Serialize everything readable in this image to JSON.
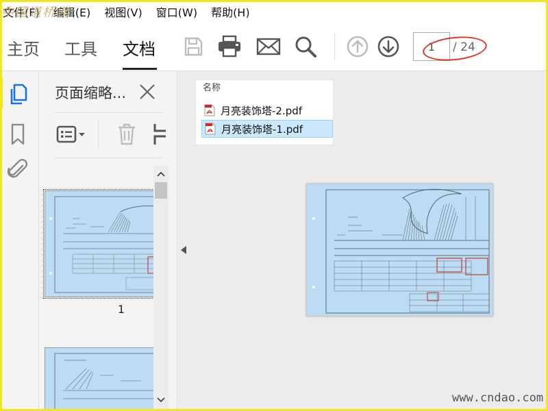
{
  "watermark_top": "中国道桥网",
  "watermark_bottom": "www.cndao.com",
  "menu": {
    "items": [
      "文件(F)",
      "编辑(E)",
      "视图(V)",
      "窗口(W)",
      "帮助(H)"
    ]
  },
  "toolbar": {
    "tabs": [
      {
        "label": "主页"
      },
      {
        "label": "工具"
      },
      {
        "label": "文档"
      }
    ],
    "active_tab": "文档",
    "page_input_value": "1",
    "page_total": "/ 24",
    "annotation_color": "#e0332a"
  },
  "panel": {
    "title": "页面缩略...",
    "thumbnails": [
      {
        "label": "1",
        "selected": true
      },
      {
        "label": ""
      }
    ]
  },
  "file_popup": {
    "header": "名称",
    "files": [
      {
        "name": "月亮装饰塔-2.pdf",
        "selected": false
      },
      {
        "name": "月亮装饰塔-1.pdf",
        "selected": true
      }
    ]
  },
  "colors": {
    "accent_yellow": "#f2e61c",
    "icon_blue": "#1a73d8",
    "blueprint": "#bcdcf4",
    "selection": "#cce8ff"
  },
  "icons": {
    "rail": [
      "pages-icon",
      "bookmark-icon",
      "attachment-icon"
    ],
    "tools": [
      "save-icon",
      "print-icon",
      "email-icon",
      "search-icon",
      "previous-page-icon",
      "next-page-icon"
    ]
  }
}
